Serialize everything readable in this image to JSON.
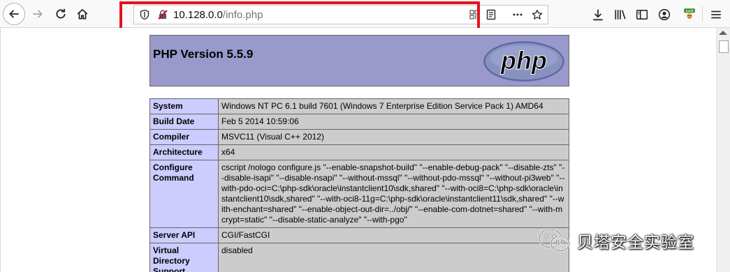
{
  "browser": {
    "url_host": "10.128.0.0",
    "url_path": "/info.php",
    "sock_badge": "sock"
  },
  "php": {
    "version_title": "PHP Version 5.5.9",
    "logo_text": "php"
  },
  "info_rows": [
    {
      "label": "System",
      "value": "Windows NT PC 6.1 build 7601 (Windows 7 Enterprise Edition Service Pack 1) AMD64"
    },
    {
      "label": "Build Date",
      "value": "Feb 5 2014 10:59:06"
    },
    {
      "label": "Compiler",
      "value": "MSVC11 (Visual C++ 2012)"
    },
    {
      "label": "Architecture",
      "value": "x64"
    },
    {
      "label": "Configure Command",
      "value": "cscript /nologo configure.js \"--enable-snapshot-build\" \"--enable-debug-pack\" \"--disable-zts\" \"--disable-isapi\" \"--disable-nsapi\" \"--without-mssql\" \"--without-pdo-mssql\" \"--without-pi3web\" \"--with-pdo-oci=C:\\php-sdk\\oracle\\instantclient10\\sdk,shared\" \"--with-oci8=C:\\php-sdk\\oracle\\instantclient10\\sdk,shared\" \"--with-oci8-11g=C:\\php-sdk\\oracle\\instantclient11\\sdk,shared\" \"--with-enchant=shared\" \"--enable-object-out-dir=../obj/\" \"--enable-com-dotnet=shared\" \"--with-mcrypt=static\" \"--disable-static-analyze\" \"--with-pgo\""
    },
    {
      "label": "Server API",
      "value": "CGI/FastCGI"
    },
    {
      "label": "Virtual Directory Support",
      "value": "disabled"
    }
  ],
  "watermark": {
    "text": "贝塔安全实验室"
  },
  "colors": {
    "highlight": "#e8101e",
    "php_header_bg": "#9999cc",
    "label_bg": "#ccccff",
    "value_bg": "#cccccc"
  }
}
